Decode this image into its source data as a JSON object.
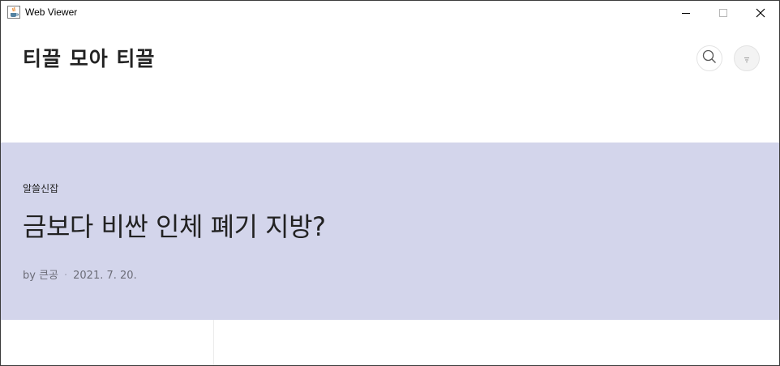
{
  "window": {
    "title": "Web Viewer",
    "app_icon": "java-coffee-icon",
    "controls": [
      "minimize-icon",
      "maximize-icon",
      "close-icon"
    ]
  },
  "header": {
    "site_title": "티끌 모아 티끌",
    "search_icon": "search-icon",
    "menu_icon": "menu-icon"
  },
  "hero": {
    "background": "#d3d5eb",
    "category": "알쓸신잡",
    "title": "금보다 비싼 인체 폐기 지방?",
    "author": "by 큰공",
    "date": "2021. 7. 20."
  }
}
